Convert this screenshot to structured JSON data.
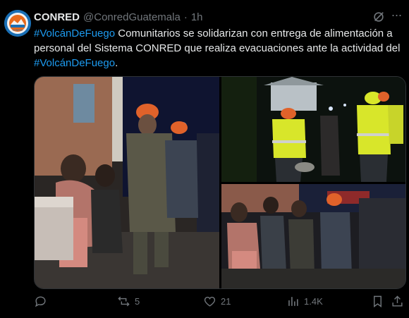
{
  "author": {
    "name": "CONRED",
    "handle": "@ConredGuatemala",
    "separator": "·",
    "time": "1h",
    "avatar_text": "CONRED"
  },
  "tweet": {
    "segments": [
      {
        "text": "#VolcánDeFuego",
        "type": "hashtag"
      },
      {
        "text": " Comunitarios se solidarizan con entrega de alimentación a personal del Sistema CONRED que realiza evacuaciones ante la actividad del ",
        "type": "text"
      },
      {
        "text": "#VolcánDeFuego",
        "type": "hashtag"
      },
      {
        "text": ".",
        "type": "text"
      }
    ]
  },
  "media": {
    "photos": [
      "photo-1",
      "photo-2",
      "photo-3"
    ]
  },
  "actions": {
    "reply": {
      "icon": "reply-icon",
      "count": ""
    },
    "repost": {
      "icon": "repost-icon",
      "count": "5"
    },
    "like": {
      "icon": "heart-icon",
      "count": "21"
    },
    "views": {
      "icon": "views-icon",
      "count": "1.4K"
    },
    "bookmark": {
      "icon": "bookmark-icon"
    },
    "share": {
      "icon": "share-icon"
    }
  },
  "colors": {
    "background": "#000000",
    "text": "#e7e9ea",
    "secondary": "#71767b",
    "hashtag": "#1d9bf0"
  }
}
